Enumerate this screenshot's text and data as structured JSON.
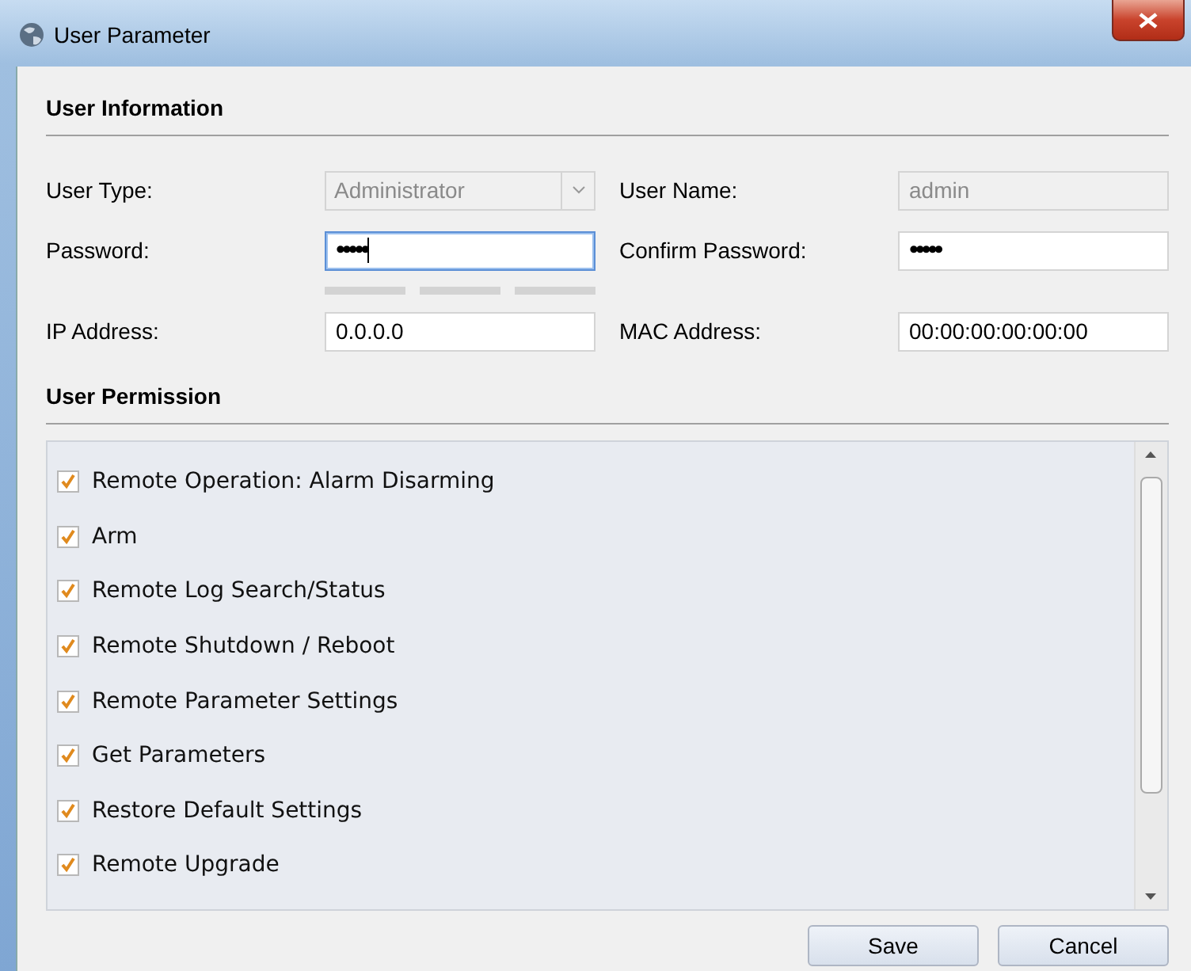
{
  "window": {
    "title": "User Parameter"
  },
  "user_information": {
    "heading": "User Information",
    "fields": [
      {
        "kind": "dropdown",
        "label": "User Type:",
        "value": "Administrator",
        "disabled": true
      },
      {
        "kind": "text",
        "label": "User Name:",
        "value": "admin",
        "disabled": true
      },
      {
        "kind": "password",
        "label": "Password:",
        "value": "•••••",
        "focused": true,
        "strength_meter": true
      },
      {
        "kind": "password",
        "label": "Confirm Password:",
        "value": "•••••",
        "focused": false
      },
      {
        "kind": "text",
        "label": "IP Address:",
        "value": "0.0.0.0",
        "disabled": false
      },
      {
        "kind": "text",
        "label": "MAC Address:",
        "value": "00:00:00:00:00:00",
        "disabled": false
      }
    ]
  },
  "user_permission": {
    "heading": "User Permission",
    "items": [
      {
        "label": "Remote Operation: Alarm Disarming",
        "checked": true
      },
      {
        "label": "Arm",
        "checked": true
      },
      {
        "label": "Remote Log Search/Status",
        "checked": true
      },
      {
        "label": "Remote Shutdown / Reboot",
        "checked": true
      },
      {
        "label": "Remote Parameter Settings",
        "checked": true
      },
      {
        "label": "Get Parameters",
        "checked": true
      },
      {
        "label": "Restore Default Settings",
        "checked": true
      },
      {
        "label": "Remote Upgrade",
        "checked": true
      }
    ]
  },
  "buttons": [
    "Save",
    "Cancel"
  ]
}
